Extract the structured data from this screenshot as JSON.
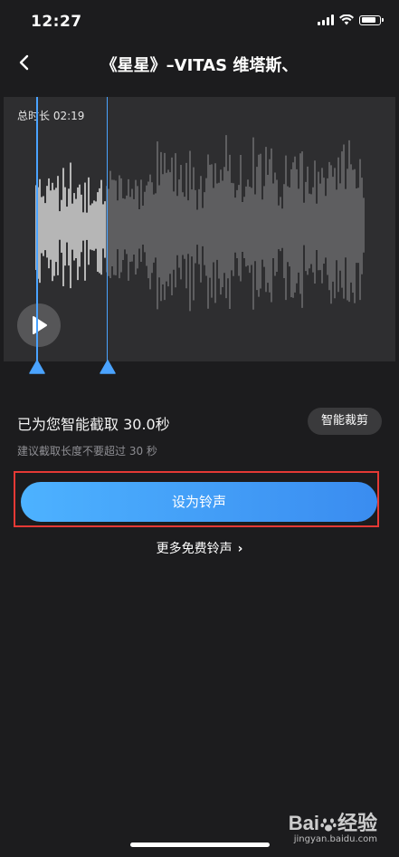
{
  "status_bar": {
    "time": "12:27"
  },
  "nav": {
    "title": "《星星》–VITAS 维塔斯、"
  },
  "waveform": {
    "duration_label": "总时长 02:19"
  },
  "trim": {
    "start_fraction": 0.0,
    "end_fraction": 0.215
  },
  "selection": {
    "info_text": "已为您智能截取 30.0秒",
    "smart_button": "智能裁剪",
    "hint": "建议截取长度不要超过 30 秒"
  },
  "actions": {
    "set_ringtone": "设为铃声",
    "more_ringtones": "更多免费铃声",
    "more_chevron": "›"
  },
  "watermark": {
    "logo_left": "Bai",
    "logo_right": "经验",
    "url": "jingyan.baidu.com"
  },
  "colors": {
    "accent": "#4aa3ff",
    "highlight": "#e53935",
    "background": "#1c1c1e"
  }
}
